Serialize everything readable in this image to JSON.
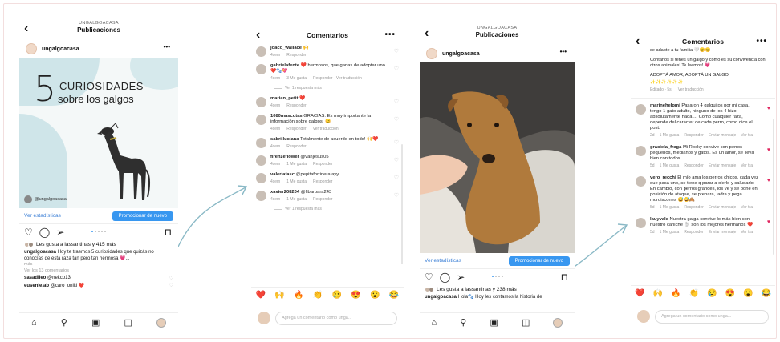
{
  "colors": {
    "accent": "#3897f0",
    "like": "#e0245e",
    "link": "#3b7fd6",
    "teal": "#cfe5e9"
  },
  "icons": {
    "back": "chevron-left",
    "more": "ellipsis",
    "heart": "heart",
    "comment": "speech-bubble",
    "share": "paper-plane",
    "save": "bookmark",
    "home": "home",
    "search": "magnifier",
    "reels": "reels",
    "shop": "shop"
  },
  "screen1": {
    "header_subtitle": "UNGALGOACASA",
    "header_title": "Publicaciones",
    "username": "ungalgoacasa",
    "post_number": "5",
    "post_line1": "CURIOSIDADES",
    "post_line2": "sobre los galgos",
    "post_handle": "@ungalgoacasa",
    "stats_link": "Ver estadísticas",
    "promote_label": "Promocionar de nuevo",
    "likes_text": "Les gusta a lassantinas y 415 más",
    "caption_user": "ungalgoacasa",
    "caption_text": "Hoy te traemos 5 curiosidades que quizás no conocías de esta raza tan pero tan hermosa 💗...",
    "caption_more": "más",
    "view_comments": "Ver los 13 comentarios",
    "comment1_user": "sasadileo",
    "comment1_text": "@nekco13",
    "comment2_user": "eusenie.ab",
    "comment2_text": "@caro_oniiti ❤️"
  },
  "screen2": {
    "title": "Comentarios",
    "comments": [
      {
        "user": "joaco_wallace",
        "text": "🙌",
        "meta1": "4sem",
        "meta2": "Responder",
        "meta3": "",
        "liked": false
      },
      {
        "user": "gabrielafente",
        "text": "❤️ hermosos, que ganas de adoptar uno❤️🐾💝",
        "meta1": "4sem",
        "meta2": "3 Me gusta",
        "meta3": "Responder · Ver traducción",
        "liked": false
      },
      {
        "user": "marian_petit",
        "text": "❤️",
        "meta1": "4sem",
        "meta2": "Responder",
        "meta3": "",
        "liked": false
      },
      {
        "user": "1080mascotas",
        "text": "GRACIAS. Es muy importante la información sobre galgos. 😊",
        "meta1": "4sem",
        "meta2": "Responder",
        "meta3": "Ver traducción",
        "liked": false
      },
      {
        "user": "sabri.luciana",
        "text": "Totalmente de acuerdo en todo! 🙌❤️",
        "meta1": "4sem",
        "meta2": "Responder",
        "meta3": "",
        "liked": false
      },
      {
        "user": "firenzeflower",
        "text": "@vanjesus05",
        "meta1": "4sem",
        "meta2": "1 Me gusta",
        "meta3": "Responder",
        "liked": false
      },
      {
        "user": "valeriafasc",
        "text": "@pepitafortinera ayy",
        "meta1": "4sem",
        "meta2": "1 Me gusta",
        "meta3": "Responder",
        "liked": false
      },
      {
        "user": "xavier208204",
        "text": "@fibarbara243",
        "meta1": "4sem",
        "meta2": "1 Me gusta",
        "meta3": "Responder",
        "liked": false
      }
    ],
    "view_reply": "Ver 1 respuesta más",
    "view_reply2": "Ver 1 respuesta más",
    "emojis": [
      "❤️",
      "🙌",
      "🔥",
      "👏",
      "😢",
      "😍",
      "😮",
      "😂"
    ],
    "input_placeholder": "Agrega un comentario como unga..."
  },
  "screen3": {
    "header_subtitle": "UNGALGOACASA",
    "header_title": "Publicaciones",
    "username": "ungalgoacasa",
    "stats_link": "Ver estadísticas",
    "promote_label": "Promocionar de nuevo",
    "likes_text": "Les gusta a lassantinas y 238 más",
    "caption_user": "ungalgoacasa",
    "caption_text": "Hola🐾 Hoy les contamos la historia de"
  },
  "screen4": {
    "title": "Comentarios",
    "top_text1": "se adapte a tu familia 🤍🙂😊",
    "top_text2": "Contanos si tenes un galgo y cómo es su convivencia con otros animales! Te leemos! 💗",
    "top_text3": "ADOPTÁ AMOR, ADOPTÁ UN GALGO!",
    "top_emojis": "✨✨✨✨✨✨",
    "top_meta1": "Editado · 5s",
    "top_meta2": "Ver traducción",
    "comments": [
      {
        "user": "marinehelpmi",
        "text": "Pasaron 4 galguitos por mi casa, tengo 1 gato adulto, ninguno de los 4 hizo absolutamente nada.... Como cualquier raza, depende del carácter de cada perro, como dice el post.",
        "meta": [
          "2d",
          "1 Me gusta",
          "Responder",
          "Enviar mensaje",
          "Ver tra"
        ]
      },
      {
        "user": "graciela_fraga",
        "text": "Mi Rocky convive con perros pequeños, medianos y gatos. Es un amor, se lleva bien con todos.",
        "meta": [
          "5d",
          "1 Me gusta",
          "Responder",
          "Enviar mensaje",
          "Ver tra"
        ]
      },
      {
        "user": "vero_recchi",
        "text": "El mío ama los perros chicos, cada vez que pasa uno, se tiene q parar a olerlo y saludarlo! En cambio, con perros grandes, los ve y se pone en posición de ataque, se prepara, ladra y pega mordiscones 😅😅🙈",
        "meta": [
          "5d",
          "1 Me gusta",
          "Responder",
          "Enviar mensaje",
          "Ver tra"
        ]
      },
      {
        "user": "lauyvale",
        "text": "Nuestra galga convive lo más bien con nuestro caniche 🐩 son los mejores hermanos ❤️",
        "meta": [
          "5d",
          "1 Me gusta",
          "Responder",
          "Enviar mensaje",
          "Ver tra"
        ]
      }
    ],
    "emojis": [
      "❤️",
      "🙌",
      "🔥",
      "👏",
      "😢",
      "😍",
      "😮",
      "😂"
    ],
    "input_placeholder": "Agrega un comentario como unga..."
  }
}
